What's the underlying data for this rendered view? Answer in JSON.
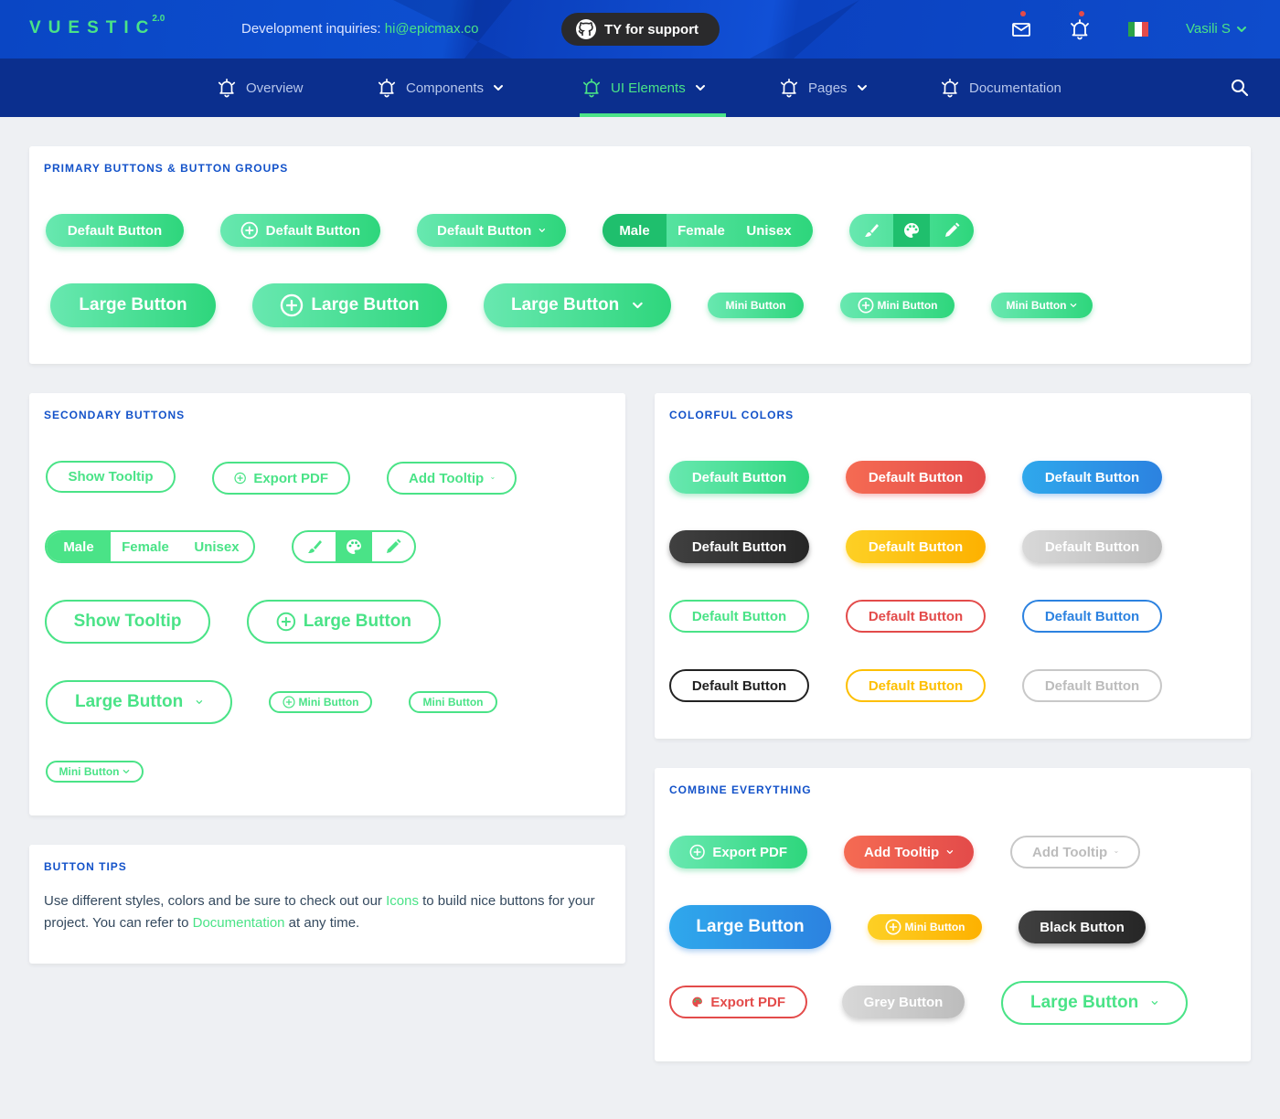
{
  "header": {
    "logo": "VUESTIC",
    "logo_version": "2.0",
    "dev_label": "Development inquiries:",
    "dev_email": "hi@epicmax.co",
    "github_button": "TY for support",
    "user_name": "Vasili S",
    "icons": [
      "mail-icon",
      "bell-icon",
      "flag-italy-icon",
      "chevron-down-icon"
    ],
    "flag_colors": [
      "#2ba348",
      "#ffffff",
      "#e34b4a"
    ]
  },
  "nav": {
    "items": [
      {
        "label": "Overview"
      },
      {
        "label": "Components"
      },
      {
        "label": "UI Elements"
      },
      {
        "label": "Pages"
      },
      {
        "label": "Documentation"
      }
    ],
    "active": "UI Elements"
  },
  "primary": {
    "title": "PRIMARY BUTTONS & BUTTON GROUPS",
    "default_button": "Default Button",
    "large_button": "Large Button",
    "mini_button": "Mini Button",
    "group_labels": [
      "Male",
      "Female",
      "Unisex"
    ],
    "icon_group": [
      "brush-icon",
      "palette-icon",
      "pencil-icon"
    ]
  },
  "secondary": {
    "title": "SECONDARY BUTTONS",
    "show_tooltip": "Show Tooltip",
    "export_pdf": "Export PDF",
    "add_tooltip": "Add Tooltip",
    "large_button": "Large Button",
    "mini_button": "Mini Button",
    "group_labels": [
      "Male",
      "Female",
      "Unisex"
    ]
  },
  "colorful": {
    "title": "COLORFUL COLORS",
    "button_label": "Default Button"
  },
  "combine": {
    "title": "COMBINE EVERYTHING",
    "export_pdf": "Export PDF",
    "add_tooltip": "Add Tooltip",
    "large_button": "Large Button",
    "mini_button": "Mini Button",
    "black_button": "Black Button",
    "grey_button": "Grey Button"
  },
  "tips": {
    "title": "BUTTON TIPS",
    "text_1": "Use different styles, colors and be sure to check out our ",
    "link_icons": "Icons",
    "text_2": " to build nice buttons for your project. You can refer to ",
    "link_docs": "Documentation",
    "text_3": " at any time."
  },
  "colors": {
    "green": "#4ae387",
    "blue_brand": "#1352c9",
    "red": "#e34b4a",
    "blue": "#2c82e0",
    "yellow": "#fdbf00",
    "dark": "#262626",
    "grey": "#bcbcbc"
  }
}
